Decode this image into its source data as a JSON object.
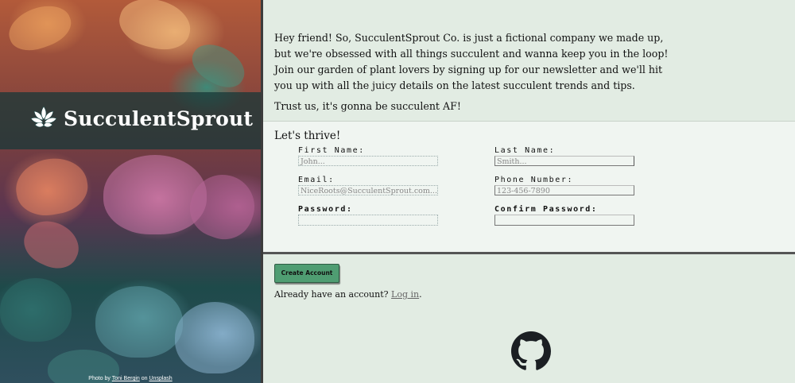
{
  "brand": {
    "name": "SucculentSprout",
    "logo_icon": "succulent-rosette-icon"
  },
  "photo_credit": {
    "prefix": "Photo by",
    "author": "Toni Bergin",
    "middle": "on",
    "source": "Unsplash"
  },
  "intro": {
    "paragraph1": "Hey friend! So, SucculentSprout Co. is just a fictional company we made up, but we're obsessed with all things succulent and wanna keep you in the loop! Join our garden of plant lovers by signing up for our newsletter and we'll hit you up with all the juicy details on the latest succulent trends and tips.",
    "paragraph2": "Trust us, it's gonna be succulent AF!"
  },
  "form": {
    "title": "Let's thrive!",
    "first_name": {
      "label": "First Name:",
      "placeholder": "John..."
    },
    "last_name": {
      "label": "Last Name:",
      "placeholder": "Smith..."
    },
    "email": {
      "label": "Email:",
      "placeholder": "NiceRoots@SucculentSprout.com..."
    },
    "phone": {
      "label": "Phone Number:",
      "placeholder": "123-456-7890"
    },
    "password": {
      "label": "Password:",
      "value": ""
    },
    "confirm_password": {
      "label": "Confirm Password:",
      "value": ""
    },
    "submit_label": "Create Account"
  },
  "login": {
    "text": "Already have an account?",
    "link": "Log in",
    "suffix": "."
  },
  "footer": {
    "icon": "github-icon"
  },
  "colors": {
    "accent": "#4f9d72",
    "background": "#e2ece3",
    "panel": "#f0f5f1"
  }
}
